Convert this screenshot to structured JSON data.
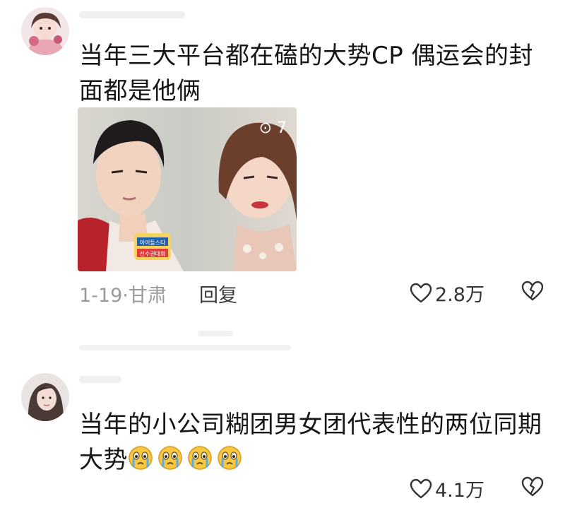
{
  "comments": [
    {
      "text": "当年三大平台都在磕的大势CP 偶运会的封面都是他俩",
      "date": "1-19",
      "location": "甘肃",
      "reply_label": "回复",
      "likes": "2.8万",
      "photo_watermark": "⊙ 7",
      "photo_badge_lines": [
        "아이돌스타",
        "선수권대회"
      ]
    },
    {
      "text": "当年的小公司糊团男女团代表性的两位同期大势",
      "emojis": [
        "crying-face",
        "crying-face",
        "crying-face",
        "crying-face"
      ],
      "likes": "4.1万"
    }
  ],
  "icons": {
    "like": "heart-outline-icon",
    "dislike": "broken-heart-icon"
  },
  "colors": {
    "text": "#161616",
    "meta": "#9a9a9a",
    "icon": "#333333"
  }
}
